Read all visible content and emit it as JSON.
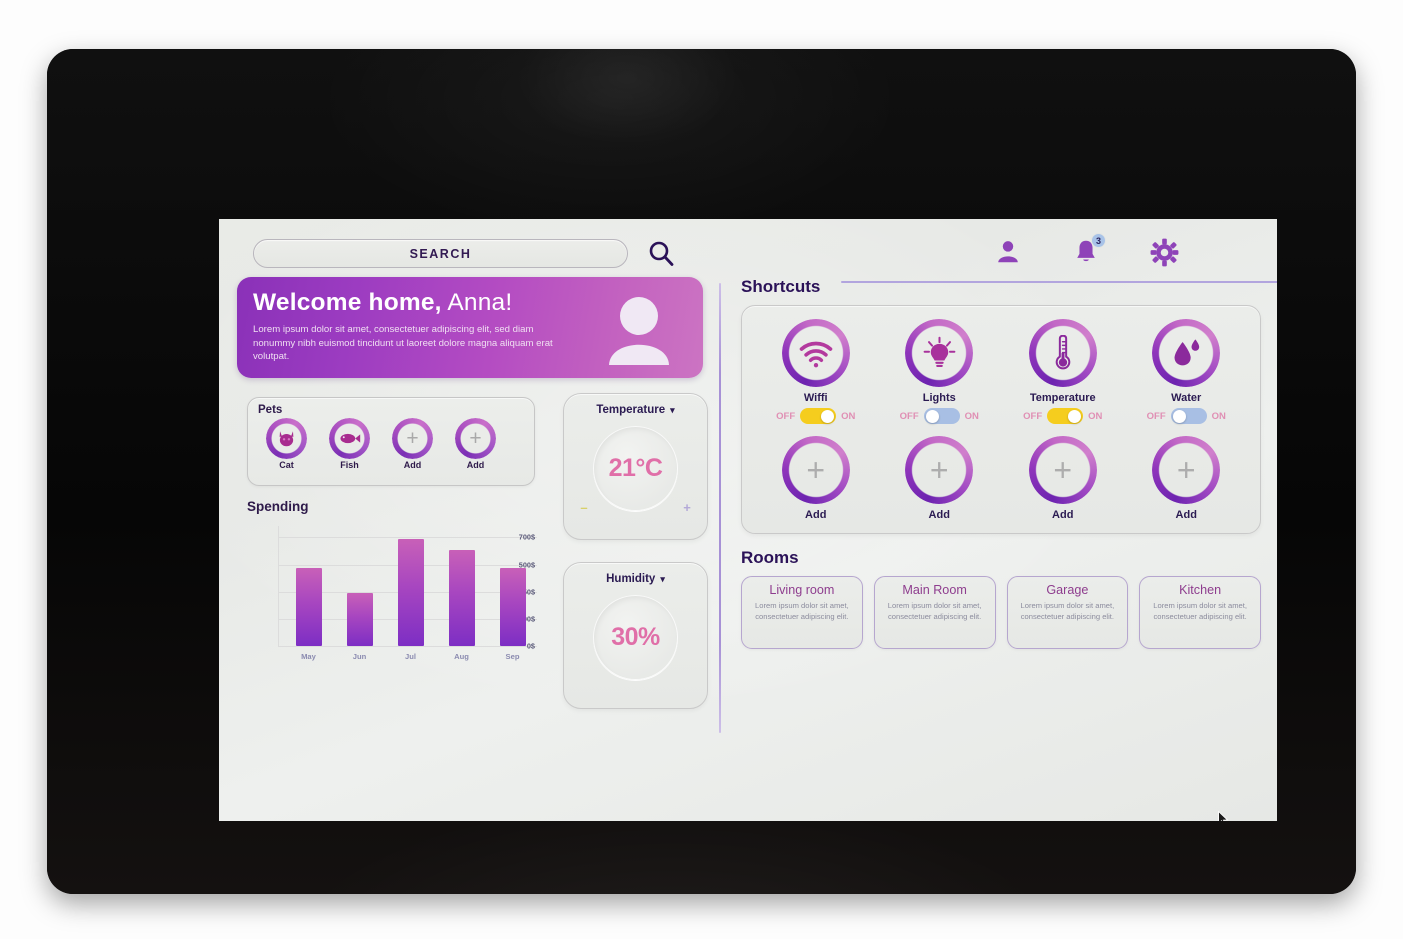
{
  "header": {
    "search_value": "SEARCH",
    "search_placeholder": "SEARCH",
    "search_icon": "search-icon",
    "profile_icon": "person-icon",
    "notifications_icon": "bell-icon",
    "notifications_badge": "3",
    "settings_icon": "gear-icon",
    "menu_icon": "hamburger-menu-icon"
  },
  "welcome": {
    "title_bold": "Welcome home,",
    "title_name": " Anna!",
    "body": "Lorem ipsum dolor sit amet, consectetuer adipiscing elit, sed diam nonummy nibh euismod tincidunt ut laoreet dolore magna aliquam erat volutpat.",
    "avatar_icon": "avatar-icon",
    "gradient_from": "#8a31b8",
    "gradient_to": "#cc74c2"
  },
  "pets": {
    "title": "Pets",
    "items": [
      {
        "label": "Cat",
        "icon": "cat-icon"
      },
      {
        "label": "Fish",
        "icon": "fish-icon"
      },
      {
        "label": "Add",
        "icon": "plus-icon"
      },
      {
        "label": "Add",
        "icon": "plus-icon"
      }
    ]
  },
  "spending": {
    "title": "Spending"
  },
  "chart_data": {
    "type": "bar",
    "title": "Spending",
    "xlabel": "",
    "ylabel": "",
    "categories": [
      "May",
      "Jun",
      "Jul",
      "Aug",
      "Sep"
    ],
    "values": [
      470,
      245,
      690,
      610,
      465
    ],
    "ytick_labels": [
      "0$",
      "100$",
      "250$",
      "500$",
      "700$"
    ],
    "ytick_values": [
      0,
      100,
      250,
      500,
      700
    ],
    "ylim": [
      0,
      780
    ],
    "grid": true,
    "legend": false,
    "bar_gradient_top": "#c860b8",
    "bar_gradient_bottom": "#7d2ec4"
  },
  "sensors": [
    {
      "title": "Temperature",
      "chevron": "chevron-down-icon",
      "value": "21°C",
      "minus_label": "–",
      "plus_label": "+",
      "has_steppers": true
    },
    {
      "title": "Humidity",
      "chevron": "chevron-down-icon",
      "value": "30%",
      "has_steppers": false
    }
  ],
  "shortcuts": {
    "title": "Shortcuts",
    "off_label": "OFF",
    "on_label": "ON",
    "items": [
      {
        "label": "Wiffi",
        "icon": "wifi-icon",
        "state": "on"
      },
      {
        "label": "Lights",
        "icon": "lightbulb-icon",
        "state": "off"
      },
      {
        "label": "Temperature",
        "icon": "thermometer-icon",
        "state": "on"
      },
      {
        "label": "Water",
        "icon": "water-drop-icon",
        "state": "off"
      }
    ],
    "add_items": [
      {
        "label": "Add",
        "icon": "plus-icon"
      },
      {
        "label": "Add",
        "icon": "plus-icon"
      },
      {
        "label": "Add",
        "icon": "plus-icon"
      },
      {
        "label": "Add",
        "icon": "plus-icon"
      }
    ]
  },
  "rooms": {
    "title": "Rooms",
    "items": [
      {
        "name": "Living room",
        "desc": "Lorem ipsum dolor sit amet, consectetuer adipiscing elit."
      },
      {
        "name": "Main Room",
        "desc": "Lorem ipsum dolor sit amet, consectetuer adipiscing elit."
      },
      {
        "name": "Garage",
        "desc": "Lorem ipsum dolor sit amet, consectetuer adipiscing elit."
      },
      {
        "name": "Kitchen",
        "desc": "Lorem ipsum dolor sit amet, consectetuer adipiscing elit."
      }
    ]
  },
  "colors": {
    "accent_purple": "#7b2fb5",
    "accent_magenta": "#c362c0",
    "toggle_on": "#f5cd1e",
    "toggle_off": "#a8bfe4",
    "value_pink": "#e06fa8",
    "heading_indigo": "#2b1258"
  }
}
